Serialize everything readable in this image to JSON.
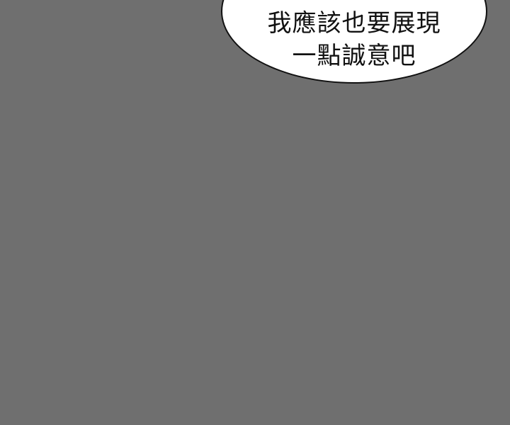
{
  "speech_bubble": {
    "lines": [
      "我應該也要展現",
      "一點誠意吧"
    ]
  },
  "colors": {
    "background": "#6f6f6f",
    "bubble_fill": "#ffffff",
    "bubble_outline": "#111111",
    "text": "#111111"
  }
}
